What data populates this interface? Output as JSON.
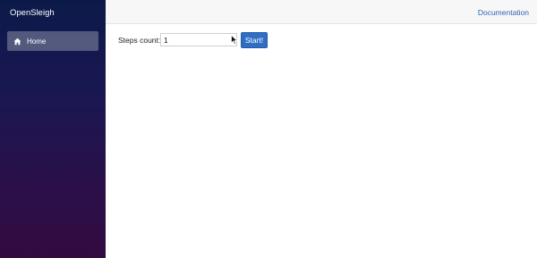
{
  "app": {
    "brand": "OpenSleigh"
  },
  "sidebar": {
    "items": [
      {
        "label": "Home",
        "icon": "home-icon"
      }
    ]
  },
  "topbar": {
    "documentation_link": "Documentation"
  },
  "main": {
    "steps_label": "Steps count:",
    "steps_value": "1",
    "start_button": "Start!"
  },
  "colors": {
    "sidebar_top": "#0c1a4a",
    "sidebar_bottom": "#330a41",
    "accent": "#2f6ec3",
    "link": "#2e63b8"
  }
}
